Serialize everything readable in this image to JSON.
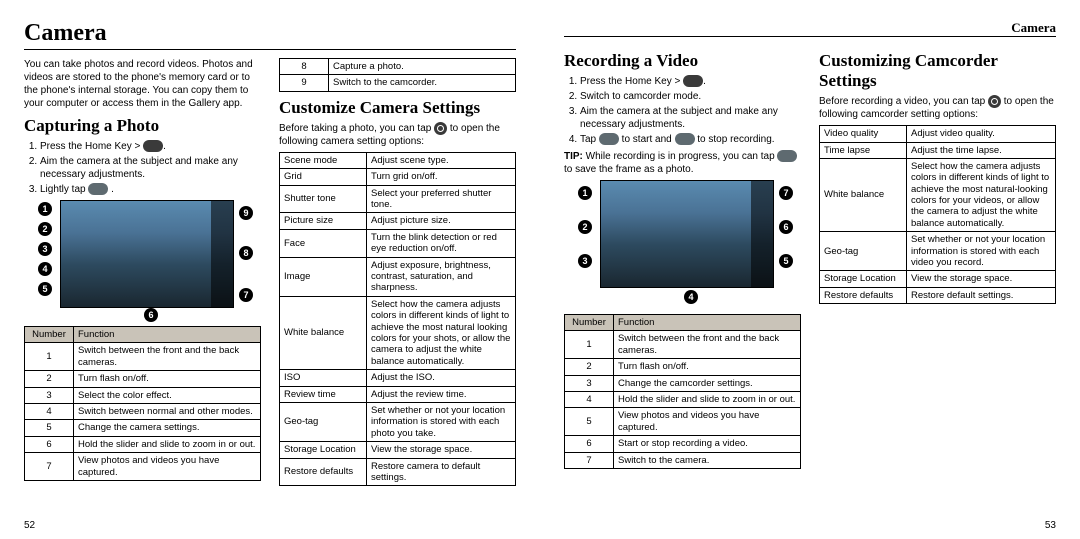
{
  "pageLeft": {
    "number": "52",
    "title": "Camera",
    "intro": "You can take photos and record videos. Photos and videos are stored to the phone's memory card or to the phone's internal storage. You can copy them to your computer or access them in the Gallery app.",
    "sectionA": {
      "heading": "Capturing a Photo",
      "step1_pre": "Press the ",
      "step1_key": "Home Key",
      "step1_post": " > ",
      "step2": "Aim the camera at the subject and make any necessary adjustments.",
      "step3_pre": "Lightly tap ",
      "numTableHeader": {
        "c1": "Number",
        "c2": "Function"
      },
      "rows": [
        {
          "n": "1",
          "f": "Switch between the front and the back cameras."
        },
        {
          "n": "2",
          "f": "Turn flash on/off."
        },
        {
          "n": "3",
          "f": "Select the color effect."
        },
        {
          "n": "4",
          "f": "Switch between normal and other modes."
        },
        {
          "n": "5",
          "f": "Change the camera settings."
        },
        {
          "n": "6",
          "f": "Hold the slider and slide to zoom in or out."
        },
        {
          "n": "7",
          "f": "View photos and videos you have captured."
        }
      ]
    },
    "contRows": [
      {
        "n": "8",
        "f": "Capture a photo."
      },
      {
        "n": "9",
        "f": "Switch to the camcorder."
      }
    ],
    "sectionB": {
      "heading": "Customize Camera Settings",
      "intro_pre": "Before taking a photo, you can tap ",
      "intro_post": " to open the following camera setting options:",
      "rows": [
        {
          "s": "Scene mode",
          "d": "Adjust scene type."
        },
        {
          "s": "Grid",
          "d": "Turn grid on/off."
        },
        {
          "s": "Shutter tone",
          "d": "Select your preferred shutter tone."
        },
        {
          "s": "Picture size",
          "d": "Adjust picture size."
        },
        {
          "s": "Face",
          "d": "Turn the blink detection or red eye reduction on/off."
        },
        {
          "s": "Image",
          "d": "Adjust exposure, brightness, contrast, saturation, and sharpness."
        },
        {
          "s": "White balance",
          "d": "Select how the camera adjusts colors in different kinds of light to achieve the most natural looking colors for your shots, or allow the camera to adjust the white balance automatically."
        },
        {
          "s": "ISO",
          "d": "Adjust the ISO."
        },
        {
          "s": "Review time",
          "d": "Adjust the review time."
        },
        {
          "s": "Geo-tag",
          "d": "Set whether or not your location information is stored with each photo you take."
        },
        {
          "s": "Storage Location",
          "d": "View the storage space."
        },
        {
          "s": "Restore defaults",
          "d": "Restore camera to default settings."
        }
      ]
    }
  },
  "pageRight": {
    "number": "53",
    "header": "Camera",
    "sectionA": {
      "heading": "Recording a Video",
      "step1_pre": "Press the ",
      "step1_key": "Home Key",
      "step1_post": " > ",
      "step2": "Switch to camcorder mode.",
      "step3": "Aim the camera at the subject and make any necessary adjustments.",
      "step4_pre": "Tap ",
      "step4_mid": " to start and ",
      "step4_post": " to stop recording.",
      "tip_label": "TIP:",
      "tip_pre": " While recording is in progress, you can tap ",
      "tip_post": " to save the frame as a photo.",
      "numTableHeader": {
        "c1": "Number",
        "c2": "Function"
      },
      "rows": [
        {
          "n": "1",
          "f": "Switch between the front and the back cameras."
        },
        {
          "n": "2",
          "f": "Turn flash on/off."
        },
        {
          "n": "3",
          "f": "Change the camcorder settings."
        },
        {
          "n": "4",
          "f": "Hold the slider and slide to zoom in or out."
        },
        {
          "n": "5",
          "f": "View photos and videos you have captured."
        },
        {
          "n": "6",
          "f": "Start or stop recording a video."
        },
        {
          "n": "7",
          "f": "Switch to the camera."
        }
      ]
    },
    "sectionB": {
      "heading": "Customizing Camcorder Settings",
      "intro_pre": "Before recording a video, you can tap ",
      "intro_post": " to open the following camcorder setting options:",
      "rows": [
        {
          "s": "Video quality",
          "d": "Adjust video quality."
        },
        {
          "s": "Time lapse",
          "d": "Adjust the time lapse."
        },
        {
          "s": "White balance",
          "d": "Select how the camera adjusts colors in different kinds of light to achieve the most natural-looking colors for your videos, or allow the camera to adjust the white balance automatically."
        },
        {
          "s": "Geo-tag",
          "d": "Set whether or not your location information is stored with each video you record."
        },
        {
          "s": "Storage Location",
          "d": "View the storage space."
        },
        {
          "s": "Restore defaults",
          "d": "Restore default settings."
        }
      ]
    }
  }
}
